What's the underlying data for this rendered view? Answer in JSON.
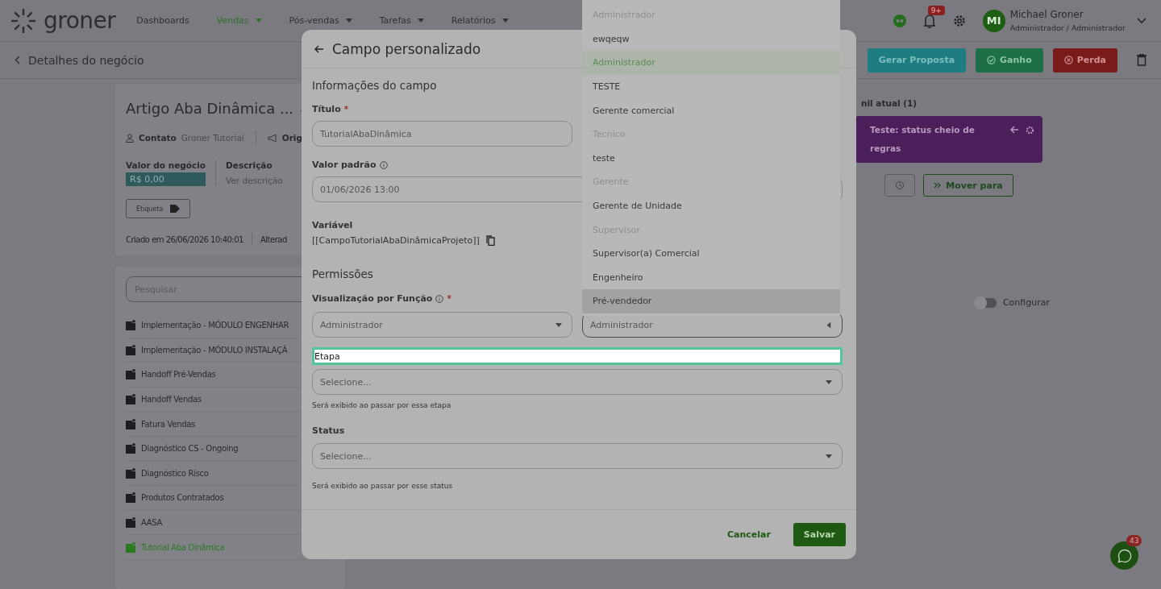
{
  "nav": {
    "logo": "groner",
    "items": [
      {
        "label": "Dashboards",
        "selected": false,
        "has_menu": false
      },
      {
        "label": "Vendas",
        "selected": true,
        "has_menu": true
      },
      {
        "label": "Pós-vendas",
        "selected": false,
        "has_menu": true
      },
      {
        "label": "Tarefas",
        "selected": false,
        "has_menu": true
      },
      {
        "label": "Relatórios",
        "selected": false,
        "has_menu": true
      }
    ],
    "notifications_badge": "9+",
    "user": {
      "initials": "MI",
      "name": "Michael Groner",
      "role": "Administrador / Administrador"
    }
  },
  "subheader": {
    "back_label": "Detalhes do negócio",
    "actions": [
      {
        "label": "Gerar Proposta",
        "kind": "proposal"
      },
      {
        "label": "Ganho",
        "kind": "won"
      },
      {
        "label": "Perda",
        "kind": "lost"
      }
    ]
  },
  "deal": {
    "title": "Artigo Aba Dinâmica ...",
    "contact_label": "Contato",
    "contact_value": "Groner Tutorial",
    "origin_label": "Orig",
    "value_label": "Valor do negócio",
    "value": "R$ 0,00",
    "description_label": "Descrição",
    "description_link": "Ver descrição",
    "tag_button": "Etiqueta",
    "created": "Criado em 26/06/2026 10:40:01",
    "updated": "Alterad"
  },
  "stages": {
    "search_placeholder": "Pesquisar",
    "items": [
      {
        "label": "Implementação - MÓDULO ENGENHAR",
        "selected": false
      },
      {
        "label": "Implementação - MÓDULO INSTALAÇÃ",
        "selected": false
      },
      {
        "label": "Handoff Pré-Vendas",
        "selected": false
      },
      {
        "label": "Handoff Vendas",
        "selected": false
      },
      {
        "label": "Fatura Vendas",
        "selected": false
      },
      {
        "label": "Diagnóstico CS - Ongoing",
        "selected": false
      },
      {
        "label": "Diagnóstico Risco",
        "selected": false
      },
      {
        "label": "Produtos Contratados",
        "selected": false
      },
      {
        "label": "AASA",
        "selected": false
      },
      {
        "label": "Tutorial Aba Dinâmica",
        "selected": true
      }
    ]
  },
  "funnel": {
    "title": "nil atual (1)",
    "status_card": "Teste: status cheio de regras",
    "move_button": "Mover para",
    "toggle_label": "Configurar",
    "toggle_on": false
  },
  "whatsapp_badge": "43",
  "modal": {
    "title": "Campo personalizado",
    "section_info": "Informações do campo",
    "title_label": "Título",
    "title_required": "*",
    "view_required": "*",
    "title_value": "TutorialAbaDinâmica",
    "default_label": "Valor padrão",
    "default_value": "01/06/2026 13:00",
    "variable_label": "Variável",
    "variable_value": "[[CampoTutorialAbaDinâmicaProjeto]]",
    "section_permissions": "Permissões",
    "view_label": "Visualização por Função",
    "view_value": "Administrador",
    "edit_value": "Administrador",
    "stage_field": "Etapa",
    "stage_placeholder": "Selecione...",
    "stage_hint": "Será exibido ao passar por essa etapa",
    "status_label": "Status",
    "status_placeholder": "Selecione...",
    "status_hint": "Será exibido ao passar por esse status",
    "cancel": "Cancelar",
    "save": "Salvar"
  },
  "dropdown": {
    "items": [
      {
        "label": "Administrador",
        "selected": false,
        "disabled": true,
        "highlighted": false
      },
      {
        "label": "ewqeqw",
        "selected": false,
        "disabled": false,
        "highlighted": false
      },
      {
        "label": "Administrador",
        "selected": true,
        "disabled": false,
        "highlighted": false
      },
      {
        "label": "TESTE",
        "selected": false,
        "disabled": false,
        "highlighted": false
      },
      {
        "label": "Gerente comercial",
        "selected": false,
        "disabled": false,
        "highlighted": false
      },
      {
        "label": "Tecnico",
        "selected": false,
        "disabled": true,
        "highlighted": false
      },
      {
        "label": "teste",
        "selected": false,
        "disabled": false,
        "highlighted": false
      },
      {
        "label": "Gerente",
        "selected": false,
        "disabled": true,
        "highlighted": false
      },
      {
        "label": "Gerente de Unidade",
        "selected": false,
        "disabled": false,
        "highlighted": false
      },
      {
        "label": "Supervisor",
        "selected": false,
        "disabled": true,
        "highlighted": false
      },
      {
        "label": "Supervisor(a) Comercial",
        "selected": false,
        "disabled": false,
        "highlighted": false
      },
      {
        "label": "Engenheiro",
        "selected": false,
        "disabled": false,
        "highlighted": false
      },
      {
        "label": "Pré-vendedor",
        "selected": false,
        "disabled": false,
        "highlighted": true
      }
    ]
  }
}
